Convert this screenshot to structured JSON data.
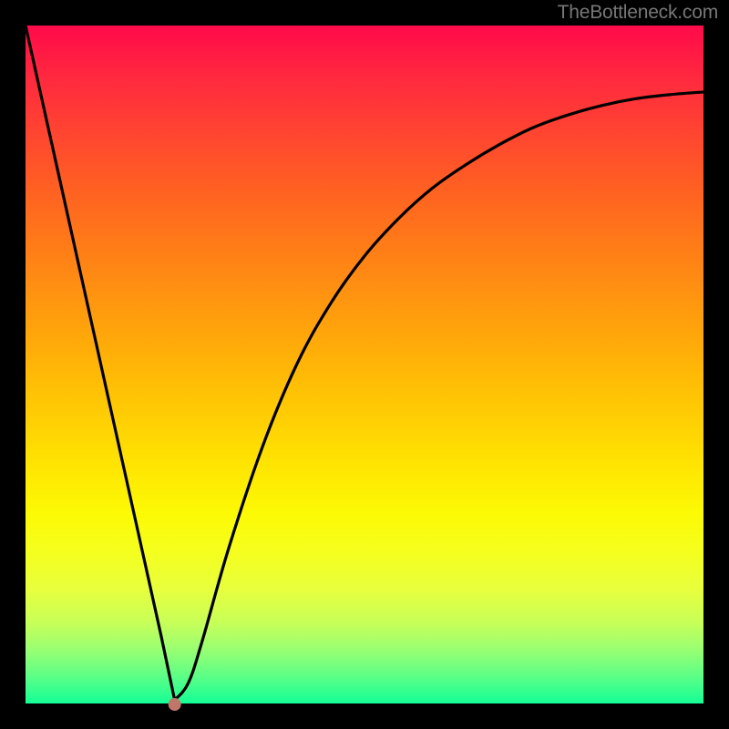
{
  "attribution": "TheBottleneck.com",
  "colors": {
    "frame": "#000000",
    "gradient_top": "#ff0a4a",
    "gradient_bottom": "#14ff96",
    "curve": "#000000",
    "min_dot": "#c0776a"
  },
  "chart_data": {
    "type": "line",
    "title": "",
    "xlabel": "",
    "ylabel": "",
    "xlim": [
      0,
      100
    ],
    "ylim": [
      0,
      100
    ],
    "axes_visible": false,
    "gradient_background": true,
    "curve_description": "V-shaped bottleneck curve: steep linear descent from top-left to the minimum, then asymptotic rise toward upper-right.",
    "min_point": {
      "x": 22,
      "y": 0
    },
    "series": [
      {
        "name": "bottleneck-curve",
        "x": [
          0,
          5,
          10,
          15,
          20,
          22,
          24,
          26,
          30,
          35,
          40,
          45,
          50,
          55,
          60,
          65,
          70,
          75,
          80,
          85,
          90,
          95,
          100
        ],
        "values": [
          100,
          77.5,
          55,
          32.5,
          10,
          0.5,
          3,
          9,
          23,
          38,
          50,
          59,
          66,
          71.5,
          76,
          79.5,
          82.5,
          85,
          86.8,
          88.2,
          89.2,
          89.8,
          90.2
        ]
      }
    ]
  }
}
